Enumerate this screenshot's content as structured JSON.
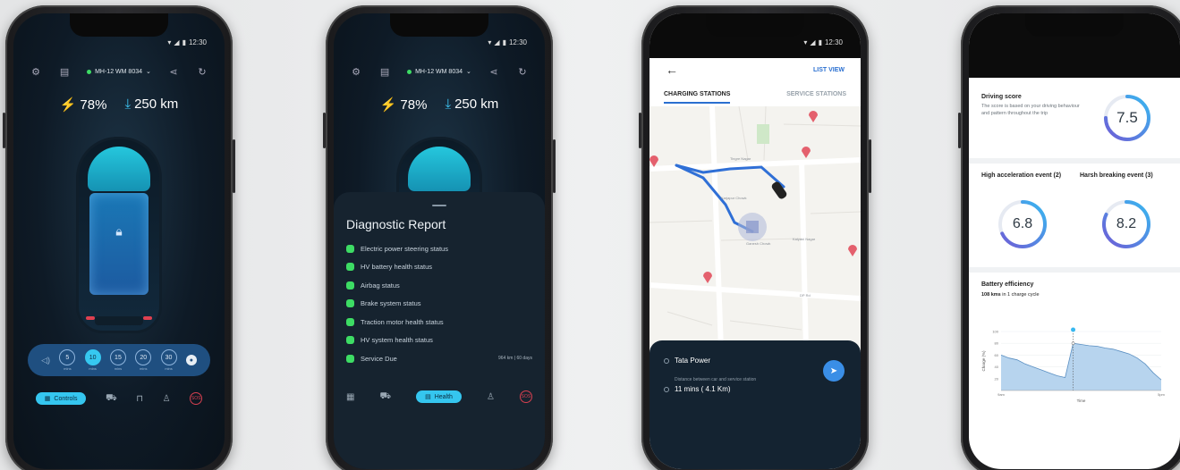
{
  "status_time": "12:30",
  "phone1": {
    "vehicle": "MH-12 WM 8034",
    "battery": "78%",
    "range": "250 km",
    "durations": [
      {
        "value": "5",
        "label": "mins"
      },
      {
        "value": "10",
        "label": "mins"
      },
      {
        "value": "15",
        "label": "mins"
      },
      {
        "value": "20",
        "label": "mins"
      },
      {
        "value": "30",
        "label": "mins"
      }
    ],
    "nav_active_label": "Controls"
  },
  "phone2": {
    "vehicle": "MH-12 WM 8034",
    "battery": "78%",
    "range": "250 km",
    "report_title": "Diagnostic Report",
    "items": [
      {
        "label": "Electric power steering status",
        "value": ""
      },
      {
        "label": "HV battery health status",
        "value": ""
      },
      {
        "label": "Airbag status",
        "value": ""
      },
      {
        "label": "Brake system status",
        "value": ""
      },
      {
        "label": "Traction motor health status",
        "value": ""
      },
      {
        "label": "HV system health status",
        "value": ""
      },
      {
        "label": "Service Due",
        "value": "964 km | 60 days"
      }
    ],
    "nav_active_label": "Health"
  },
  "phone3": {
    "list_view": "LIST VIEW",
    "tab_charging": "CHARGING STATIONS",
    "tab_service": "SERVICE STATIONS",
    "station_name": "Tata Power",
    "distance_note": "Distance between car and service station",
    "eta": "11 mins ( 4.1 Km)",
    "map_labels": [
      "Ganesh Chowk",
      "DP Rd",
      "Kalyani Nagar",
      "Karjapur Chowk",
      "Tingre Nagar"
    ]
  },
  "phone4": {
    "driving_title": "Driving score",
    "driving_desc": "The score is based on your driving behaviour and pattern throughout the trip",
    "driving_score": "7.5",
    "accel_title": "High acceleration event (2)",
    "accel_score": "6.8",
    "brake_title": "Harsh breaking event (3)",
    "brake_score": "8.2",
    "battery_title": "Battery efficiency",
    "battery_sub_strong": "108 kms",
    "battery_sub": "in 1 charge cycle"
  },
  "chart_data": {
    "type": "area",
    "title": "Battery efficiency",
    "xlabel": "Time",
    "ylabel": "Charge (%)",
    "x_ticks": [
      "9am",
      "",
      "5pm"
    ],
    "y_ticks": [
      20,
      40,
      60,
      80,
      100
    ],
    "ylim": [
      0,
      100
    ],
    "x": [
      0,
      1,
      2,
      3,
      4,
      5,
      6,
      7,
      8,
      9,
      10,
      11,
      12,
      13,
      14,
      15,
      16,
      17,
      18,
      19,
      20
    ],
    "values": [
      60,
      55,
      52,
      45,
      40,
      35,
      30,
      25,
      22,
      80,
      78,
      76,
      75,
      72,
      70,
      66,
      62,
      55,
      45,
      30,
      18
    ],
    "marker_index": 9
  }
}
